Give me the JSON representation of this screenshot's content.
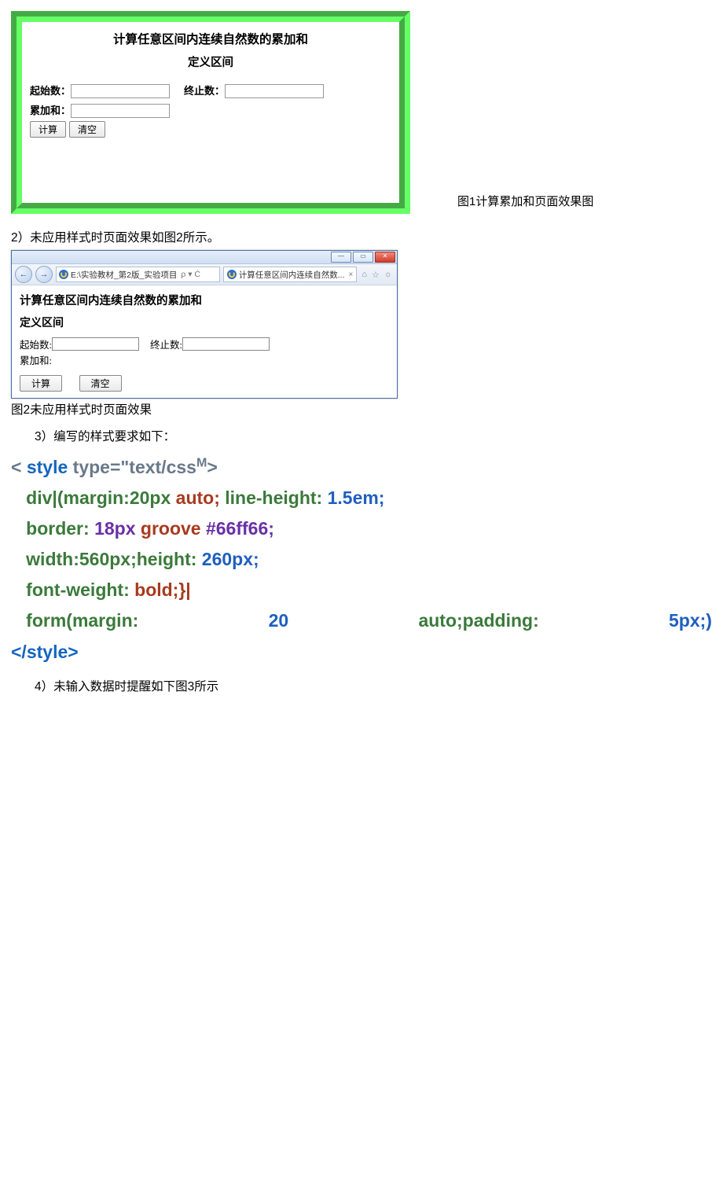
{
  "figure1": {
    "title": "计算任意区间内连续自然数的累加和",
    "subtitle": "定义区间",
    "start_label": "起始数：",
    "end_label": "终止数：",
    "sum_label": "累加和：",
    "btn_calc": "计算",
    "btn_clear": "清空",
    "caption": "图1计算累加和页面效果图"
  },
  "para1": "2）未应用样式时页面效果如图2所示。",
  "figure2": {
    "address_text": "E:\\实验教材_第2版_实验项目",
    "search_hint": "ρ ▾ Ċ",
    "tab_title": "计算任意区间内连续自然数...",
    "title": "计算任意区间内连续自然数的累加和",
    "subtitle": "定义区间",
    "start_label": "起始数:",
    "end_label": "终止数:",
    "sum_label": "累加和:",
    "btn_calc": "计算",
    "btn_clear": "清空",
    "caption": "图2未应用样式时页面效果"
  },
  "item3": "3）编写的样式要求如下：",
  "code": {
    "l1a": "< ",
    "l1b": "style",
    "l1c": " type=\"text/css",
    "l1d": "M",
    "l1e": ">",
    "l2a": "   div|(margin:20px ",
    "l2b": "auto;",
    "l2c": " line-height: ",
    "l2d": "1.5em;",
    "l3a": "   border: ",
    "l3b": "18px ",
    "l3c": "groove ",
    "l3d": "#66ff66;",
    "l4a": "   width:560px;height: ",
    "l4b": "260px;",
    "l5a": "   font-weight: ",
    "l5b": "bold;}|",
    "l6a": "   form(margin:",
    "l6b": "20",
    "l6c": "auto;padding:",
    "l6d": "5px;)",
    "l7": "</style>"
  },
  "item4": "4）未输入数据时提醒如下图3所示"
}
